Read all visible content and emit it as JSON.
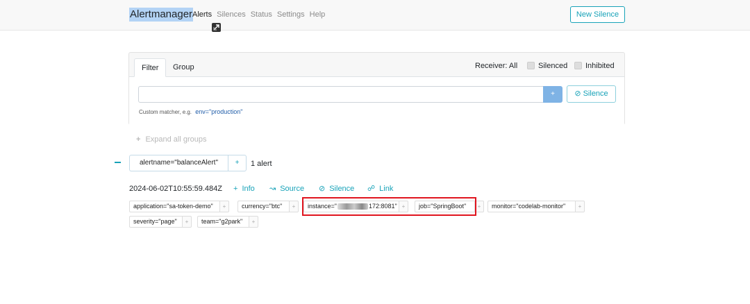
{
  "header": {
    "brand": "Alertmanager",
    "nav": [
      "Alerts",
      "Silences",
      "Status",
      "Settings",
      "Help"
    ],
    "new_silence_label": "New Silence"
  },
  "filter_card": {
    "tabs": [
      "Filter",
      "Group"
    ],
    "receiver_label": "Receiver: All",
    "silenced_label": "Silenced",
    "inhibited_label": "Inhibited",
    "input_value": "",
    "add_button_label": "+",
    "silence_button_label": "Silence",
    "hint_text": "Custom matcher, e.g.",
    "hint_code": "env=\"production\""
  },
  "expand_all_label": "Expand all groups",
  "group": {
    "matcher": "alertname=\"balanceAlert\"",
    "add_label": "+",
    "count_label": "1 alert"
  },
  "alert": {
    "timestamp": "2024-06-02T10:55:59.484Z",
    "actions": [
      "Info",
      "Source",
      "Silence",
      "Link"
    ],
    "labels": [
      "application=\"sa-token-demo\"",
      "currency=\"btc\"",
      "instance=\"",
      "172:8081\"",
      "job=\"SpringBoot\"",
      "monitor=\"codelab-monitor\"",
      "severity=\"page\"",
      "team=\"g2park\""
    ],
    "label_plus": "+"
  },
  "colors": {
    "accent": "#17a2b8",
    "primary_light": "#7fb3e5",
    "highlight": "#e0141e"
  }
}
